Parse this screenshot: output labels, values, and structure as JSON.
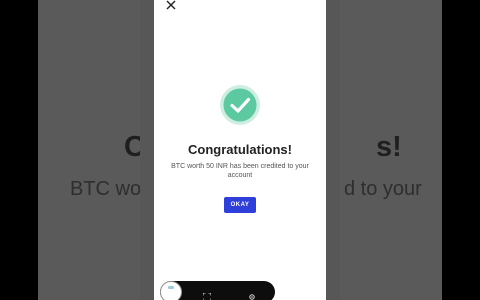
{
  "background": {
    "title_left": "C",
    "title_right": "s!",
    "subtitle_left": "BTC wort",
    "subtitle_right": "d to your"
  },
  "dialog": {
    "title": "Congratulations!",
    "message": "BTC worth 50 INR has been credited to your account",
    "okay_label": "OKAY",
    "close_icon": "close-icon",
    "success_icon": "check-circle-icon"
  },
  "toolbar": {
    "avatar_icon": "avatar",
    "fullscreen_icon": "fullscreen-icon",
    "settings_icon": "settings-icon"
  },
  "colors": {
    "accent": "#2f3fd9",
    "success": "#5cc9a0"
  }
}
